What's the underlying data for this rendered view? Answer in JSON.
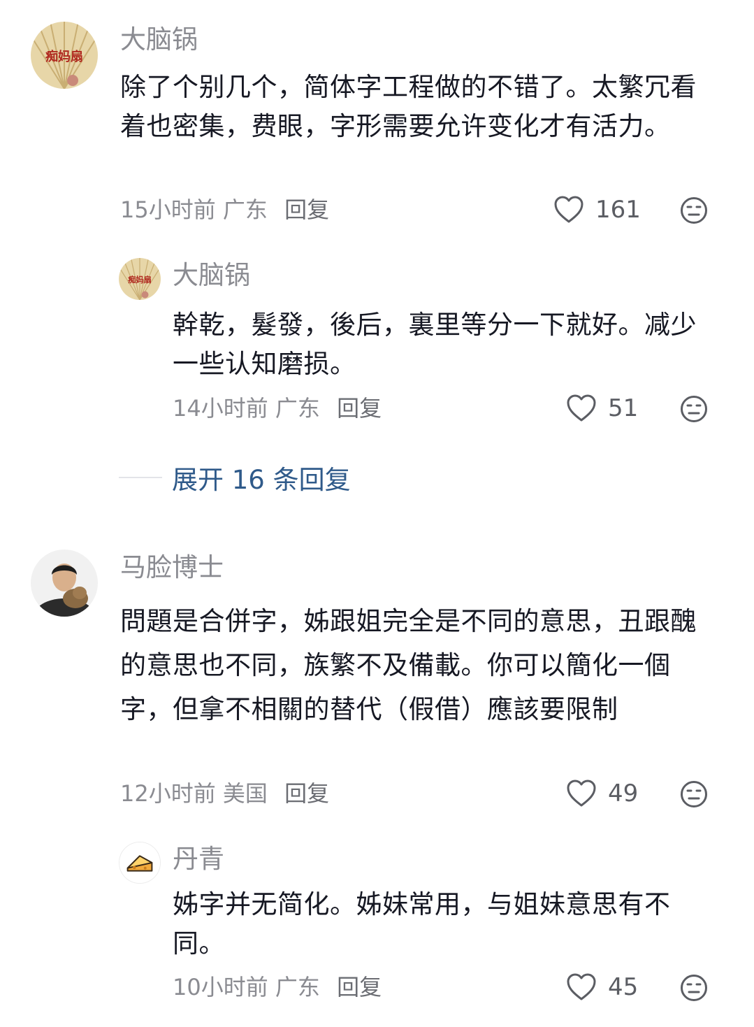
{
  "comments": [
    {
      "user": "大脑锅",
      "text": "除了个别几个，简体字工程做的不错了。太繁冗看着也密集，费眼，字形需要允许变化才有活力。",
      "time": "15小时前",
      "location": "广东",
      "reply_label": "回复",
      "likes": "161",
      "replies": [
        {
          "user": "大脑锅",
          "text": "幹乾，髮發，後后，裏里等分一下就好。减少一些认知磨损。",
          "time": "14小时前",
          "location": "广东",
          "reply_label": "回复",
          "likes": "51"
        }
      ],
      "expand_label": "展开 16 条回复"
    },
    {
      "user": "马脸博士",
      "text": "問題是合併字，姊跟姐完全是不同的意思，丑跟醜的意思也不同，族繁不及備載。你可以簡化一個字，但拿不相關的替代（假借）應該要限制",
      "time": "12小时前",
      "location": "美国",
      "reply_label": "回复",
      "likes": "49",
      "replies": [
        {
          "user": "丹青",
          "text": "姊字并无简化。姊妹常用，与姐妹意思有不同。",
          "time": "10小时前",
          "location": "广东",
          "reply_label": "回复",
          "likes": "45"
        }
      ]
    }
  ],
  "icons": {
    "like": "heart-outline-icon",
    "dislike": "neutral-face-icon",
    "avatar1": "fan-avatar",
    "avatar2": "man-with-cat-avatar",
    "avatar3": "cheese-avatar"
  },
  "colors": {
    "text": "#161823",
    "muted": "#8a8b91",
    "link": "#2f5a8a"
  }
}
